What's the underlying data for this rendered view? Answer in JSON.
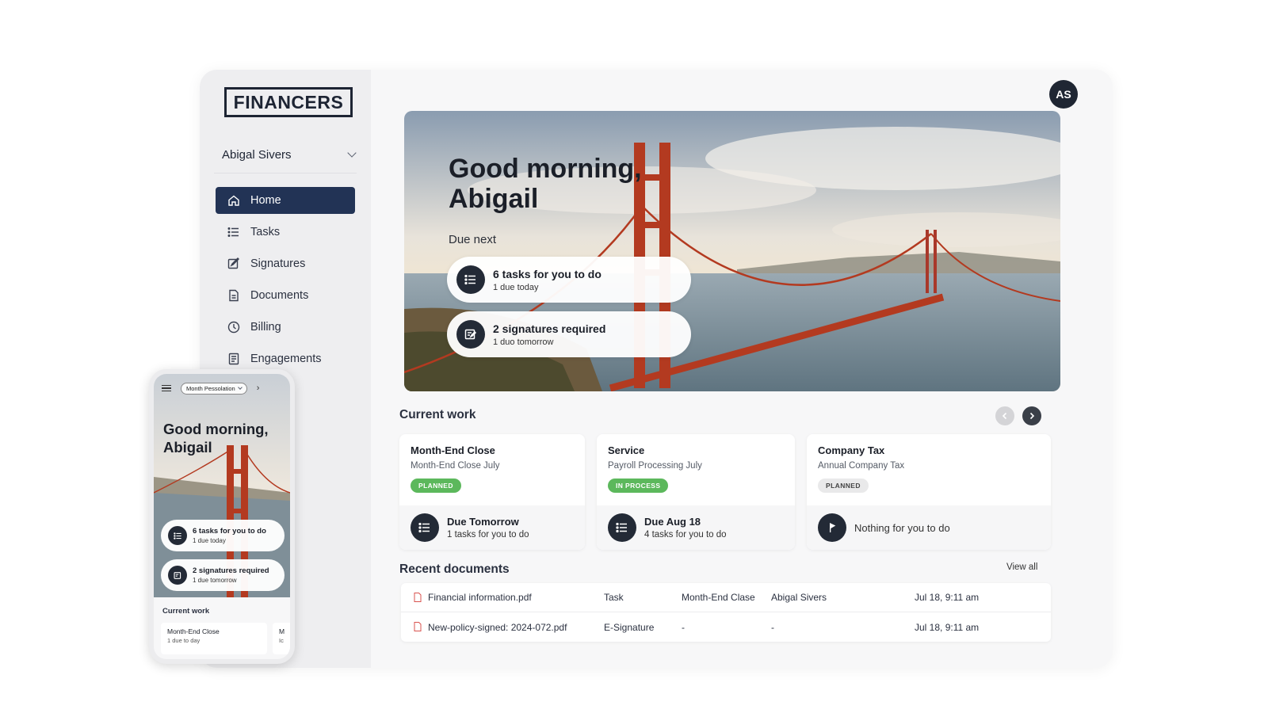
{
  "brand": {
    "logo": "FINANCERS"
  },
  "account": {
    "name": "Abigal Sivers"
  },
  "sidebar": {
    "items": [
      {
        "label": "Home",
        "icon": "home-icon",
        "active": true
      },
      {
        "label": "Tasks",
        "icon": "list-icon"
      },
      {
        "label": "Signatures",
        "icon": "signature-icon"
      },
      {
        "label": "Documents",
        "icon": "document-icon"
      },
      {
        "label": "Billing",
        "icon": "clock-icon"
      },
      {
        "label": "Engagements",
        "icon": "engagement-icon"
      }
    ]
  },
  "header": {
    "avatar_initials": "AS"
  },
  "hero": {
    "greeting_line1": "Good morning,",
    "greeting_line2": "Abigail",
    "due_label": "Due next",
    "cards": [
      {
        "title": "6 tasks for you to do",
        "subtitle": "1 due today",
        "icon": "list-icon"
      },
      {
        "title": "2 signatures required",
        "subtitle": "1 duo tomorrow",
        "icon": "signature-icon"
      }
    ]
  },
  "current_work": {
    "title": "Current work",
    "cards": [
      {
        "title": "Month-End Close",
        "subtitle": "Month-End Close July",
        "status": "PLANNED",
        "status_color": "#5cb85c",
        "due_title": "Due Tomorrow",
        "due_sub": "1 tasks for you to do"
      },
      {
        "title": "Service",
        "subtitle": "Payroll Processing July",
        "status": "IN PROCESS",
        "status_color": "#5cb85c",
        "due_title": "Due Aug 18",
        "due_sub": "4 tasks for you to do"
      },
      {
        "title": "Company Tax",
        "subtitle": "Annual Company Tax",
        "status": "PLANNED",
        "status_color": "#e9e9ea",
        "due_only": "Nothing for you to do"
      }
    ]
  },
  "recent_documents": {
    "title": "Recent documents",
    "view_all": "View all",
    "rows": [
      {
        "name": "Financial information.pdf",
        "type": "Task",
        "engagement": "Month-End Clase",
        "owner": "Abigal Sivers",
        "date": "Jul 18, 9:11 am"
      },
      {
        "name": "New-policy-signed: 2024-072.pdf",
        "type": "E-Signature",
        "engagement": "-",
        "owner": "-",
        "date": "Jul 18, 9:11 am"
      }
    ]
  },
  "mobile": {
    "selector": "Month Pessolation",
    "greeting_line1": "Good morning,",
    "greeting_line2": "Abigail",
    "cards": [
      {
        "title": "6 tasks for you to do",
        "subtitle": "1 due today"
      },
      {
        "title": "2 signatures required",
        "subtitle": "1 due tomorrow"
      }
    ],
    "current_work_title": "Current work",
    "work_cards": [
      {
        "title": "Month-End Close",
        "subtitle": "1 due to day"
      },
      {
        "title": "M",
        "subtitle": "Ic"
      }
    ]
  },
  "colors": {
    "accent": "#223355",
    "dark": "#232a36",
    "status_green": "#5cb85c"
  }
}
